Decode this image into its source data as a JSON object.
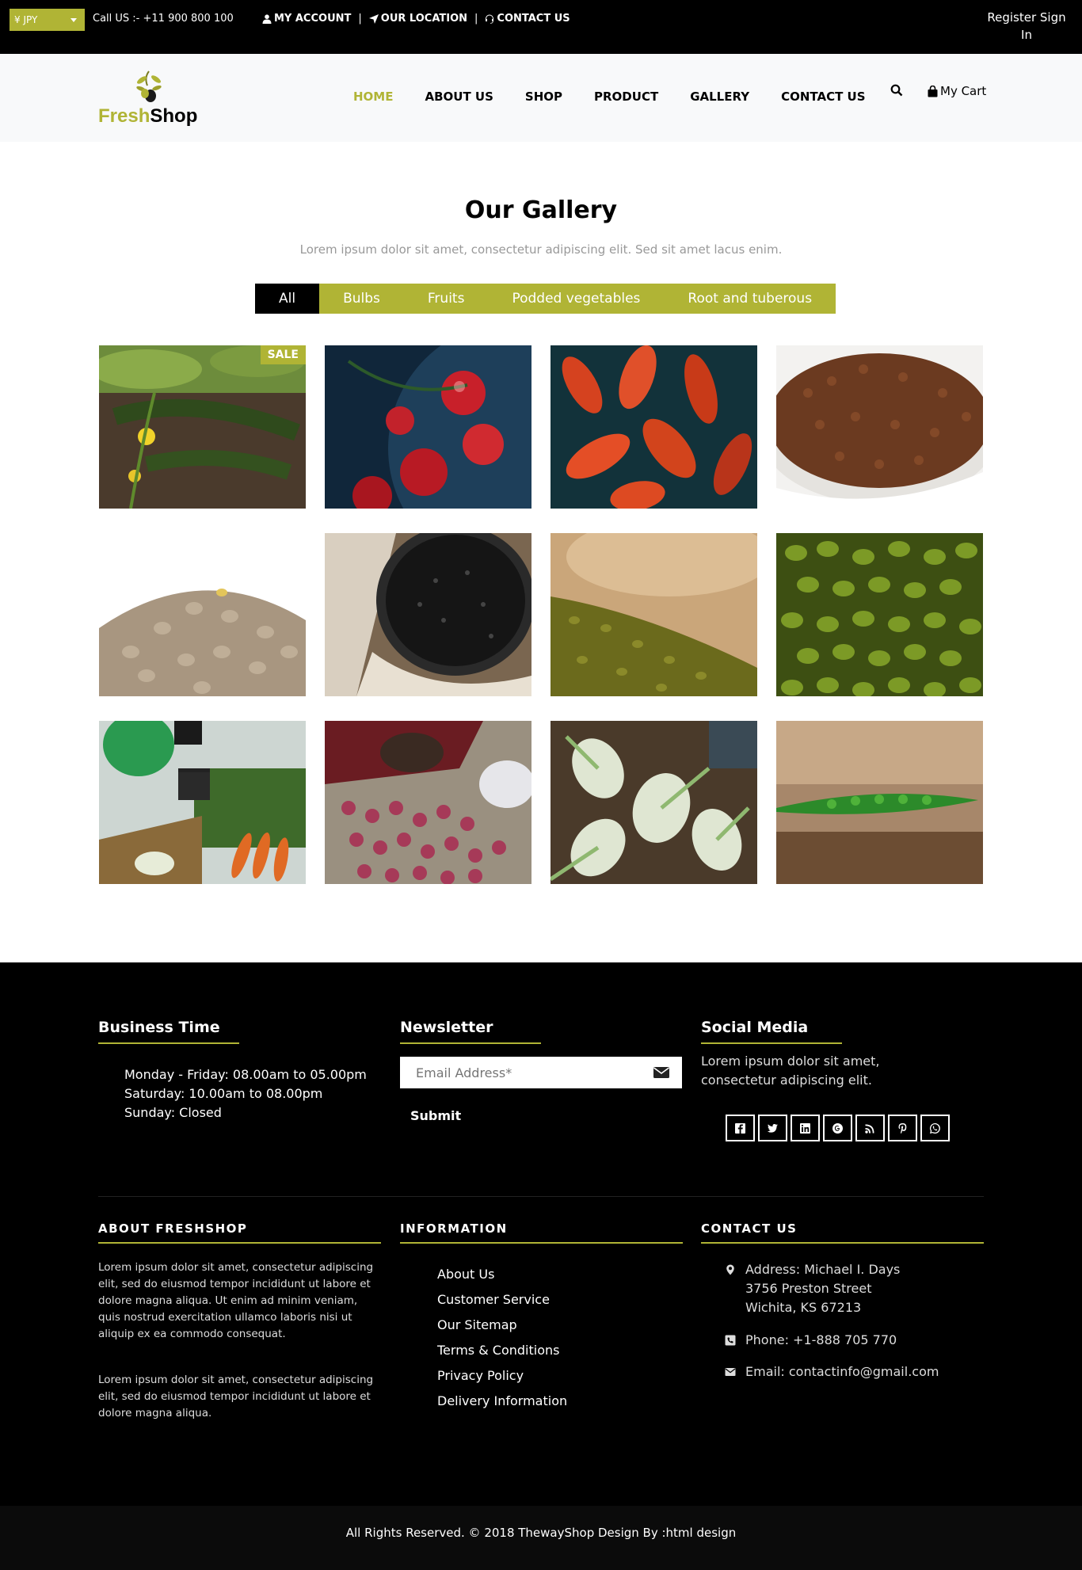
{
  "topbar": {
    "currency": "¥ JPY",
    "call": "Call US :- +11 900 800 100",
    "links": [
      "MY ACCOUNT",
      "OUR LOCATION",
      "CONTACT US"
    ],
    "register": "Register Sign In"
  },
  "header": {
    "logo_fresh": "Fresh",
    "logo_shop": "Shop",
    "nav": [
      "HOME",
      "ABOUT US",
      "SHOP",
      "PRODUCT",
      "GALLERY",
      "CONTACT US"
    ],
    "active_nav": "HOME",
    "cart": "My Cart"
  },
  "gallery": {
    "title": "Our Gallery",
    "subtitle": "Lorem ipsum dolor sit amet, consectetur adipiscing elit. Sed sit amet lacus enim.",
    "filters": [
      "All",
      "Bulbs",
      "Fruits",
      "Podded vegetables",
      "Root and tuberous"
    ],
    "active_filter": "All",
    "sale_badge": "SALE",
    "images": [
      "cucumber",
      "cherry-tomatoes",
      "red-peppers",
      "brown-lentils",
      "green-lentils",
      "black-lentils",
      "mung-beans-heap",
      "mung-beans",
      "market-vegetables",
      "shallots",
      "fennel",
      "pea-pod"
    ]
  },
  "footer": {
    "business": {
      "title": "Business Time",
      "lines": [
        "Monday - Friday: 08.00am to 05.00pm",
        "Saturday: 10.00am to 08.00pm",
        "Sunday: Closed"
      ]
    },
    "newsletter": {
      "title": "Newsletter",
      "placeholder": "Email Address*",
      "submit": "Submit"
    },
    "social": {
      "title": "Social Media",
      "text": "Lorem ipsum dolor sit amet, consectetur adipiscing elit.",
      "icons": [
        "facebook-icon",
        "twitter-icon",
        "linkedin-icon",
        "google-plus-icon",
        "rss-icon",
        "pinterest-icon",
        "whatsapp-icon"
      ]
    },
    "about": {
      "title": "ABOUT FRESHSHOP",
      "p1": "Lorem ipsum dolor sit amet, consectetur adipiscing elit, sed do eiusmod tempor incididunt ut labore et dolore magna aliqua. Ut enim ad minim veniam, quis nostrud exercitation ullamco laboris nisi ut aliquip ex ea commodo consequat.",
      "p2": "Lorem ipsum dolor sit amet, consectetur adipiscing elit, sed do eiusmod tempor incididunt ut labore et dolore magna aliqua."
    },
    "information": {
      "title": "INFORMATION",
      "links": [
        "About Us",
        "Customer Service",
        "Our Sitemap",
        "Terms & Conditions",
        "Privacy Policy",
        "Delivery Information"
      ]
    },
    "contact": {
      "title": "CONTACT US",
      "address": "Address: Michael I. Days 3756 Preston Street Wichita, KS 67213",
      "phone": "Phone: +1-888 705 770",
      "email": "Email: contactinfo@gmail.com"
    }
  },
  "copyright": "All Rights Reserved. © 2018 ThewayShop Design By :html design",
  "colors": {
    "accent": "#b0b435",
    "dark": "#000000"
  }
}
